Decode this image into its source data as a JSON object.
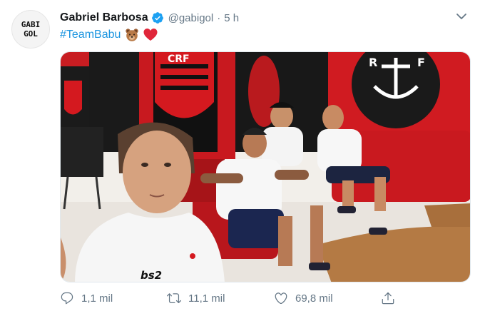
{
  "tweet": {
    "author_name": "Gabriel Barbosa",
    "handle": "@gabigol",
    "separator": "·",
    "time": "5 h",
    "hashtag": "#TeamBabu",
    "avatar_text": "GABIGOL",
    "verified": true
  },
  "media": {
    "shirt_text": "bs2"
  },
  "actions": {
    "reply_count": "1,1 mil",
    "retweet_count": "11,1 mil",
    "like_count": "69,8 mil"
  },
  "icons": {
    "verified": "verified-badge-icon",
    "chevron": "chevron-down-icon",
    "bear": "bear-emoji-icon",
    "heart": "red-heart-emoji-icon",
    "reply": "reply-icon",
    "retweet": "retweet-icon",
    "like": "like-icon",
    "share": "share-icon"
  },
  "colors": {
    "link": "#1b95e0",
    "secondary_text": "#657786",
    "flamengo_red": "#d4191f"
  }
}
